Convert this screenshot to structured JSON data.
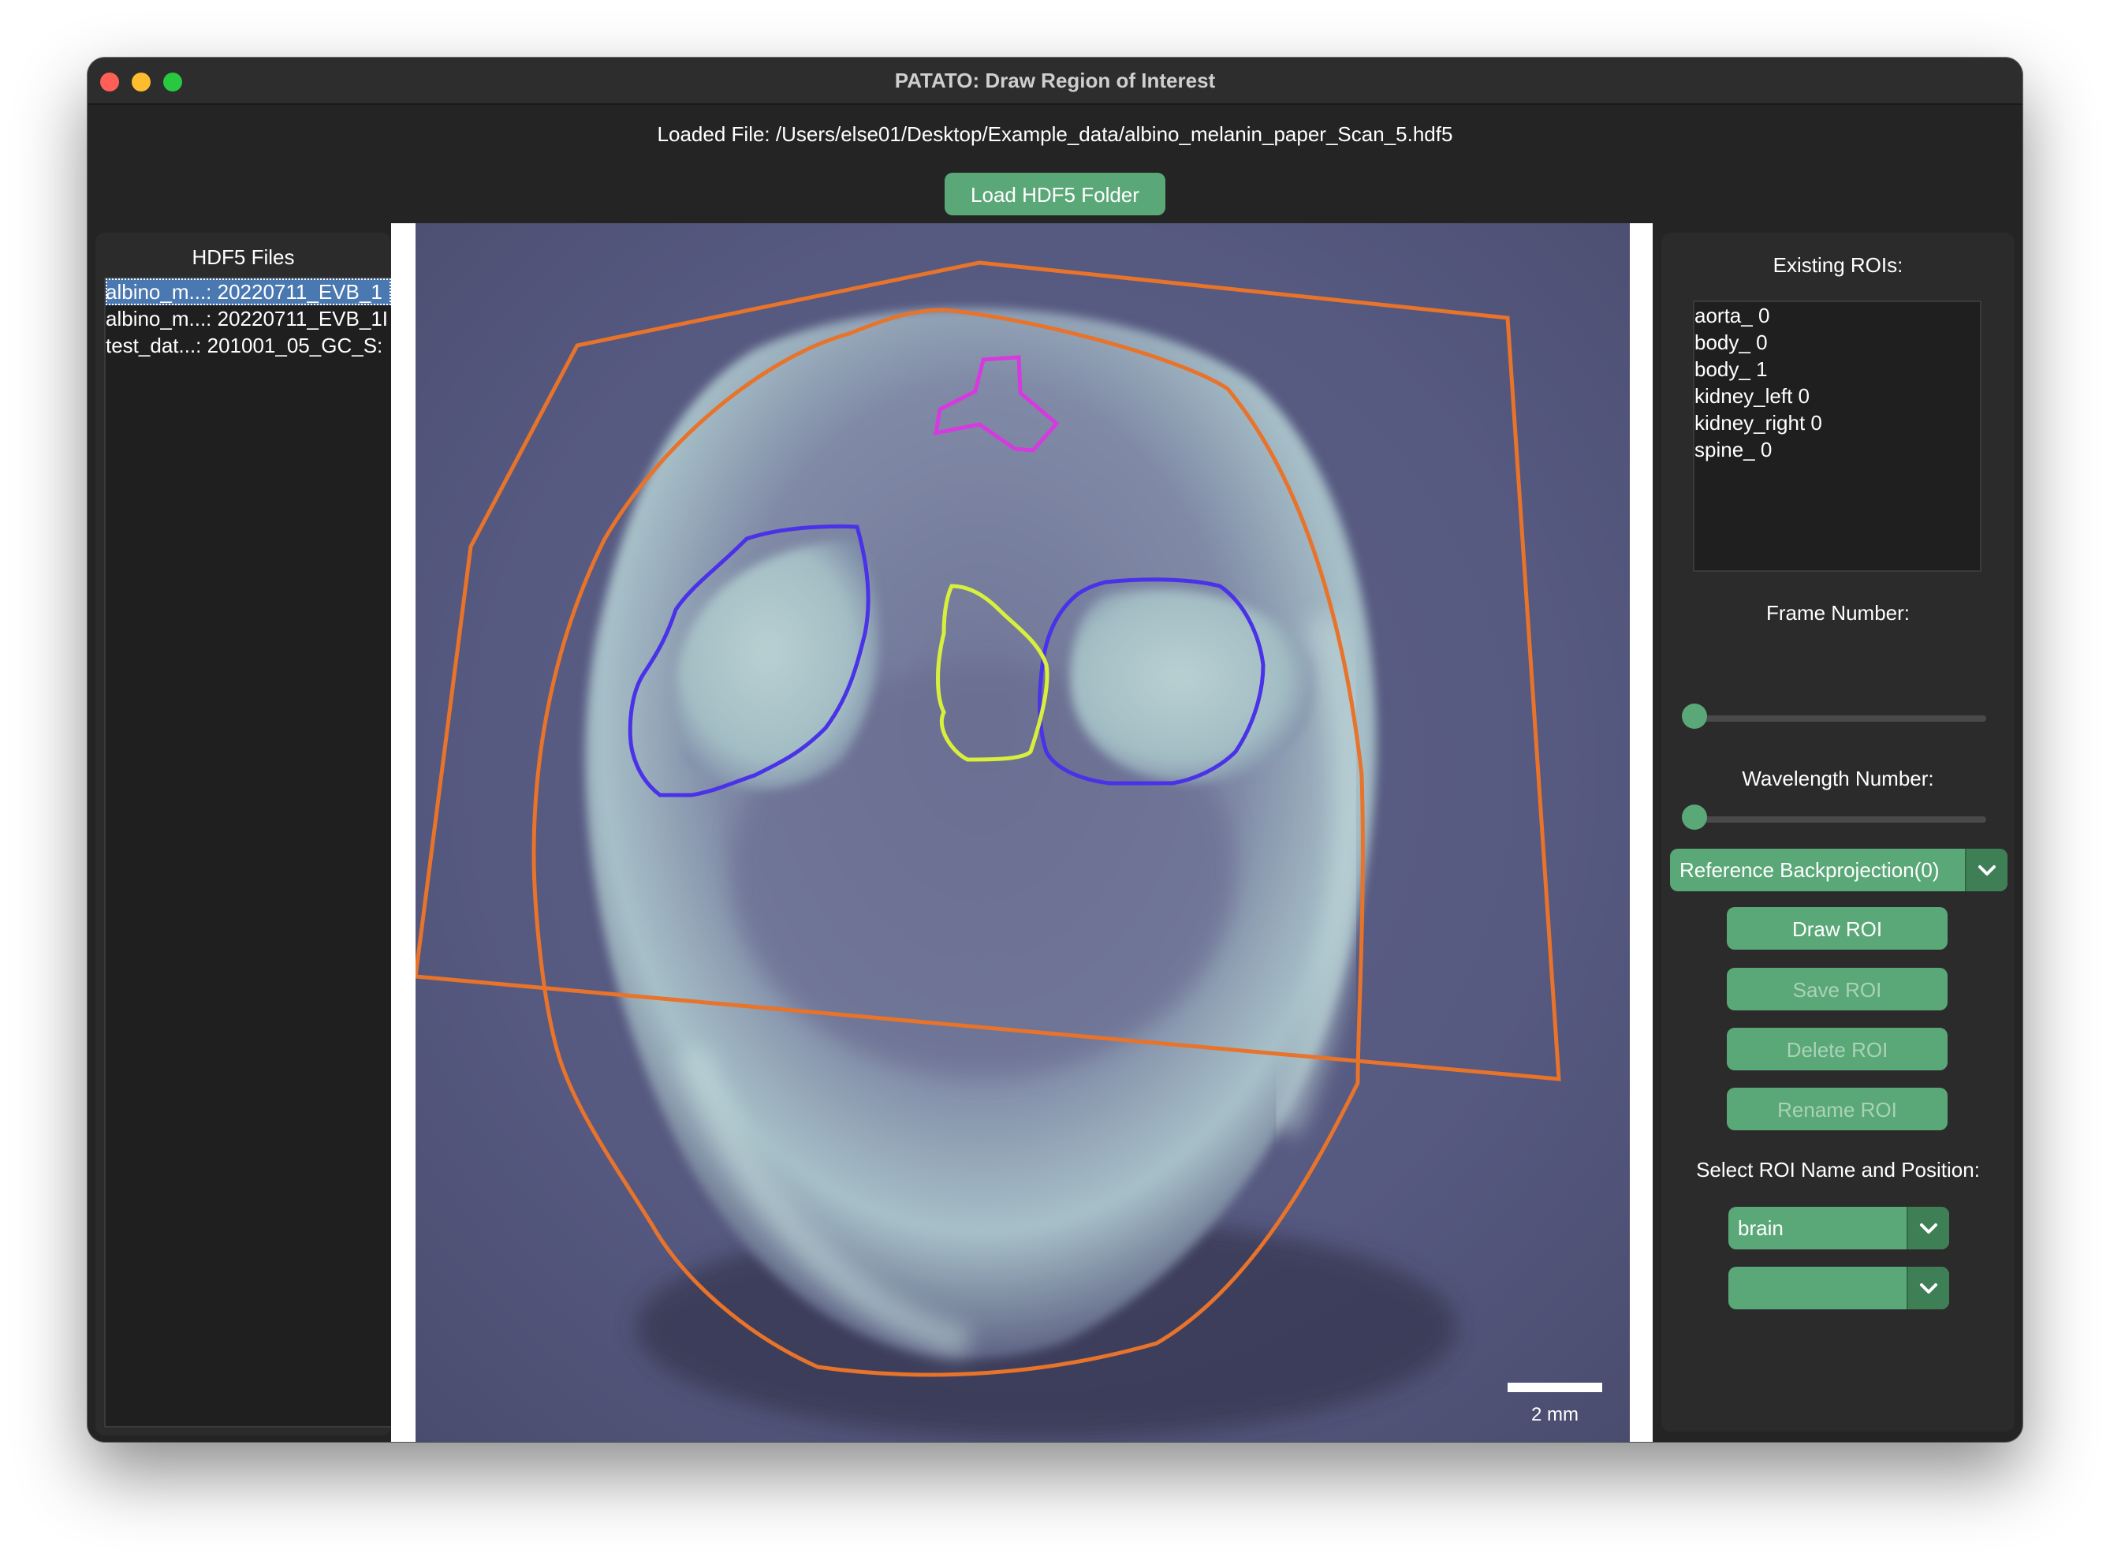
{
  "window": {
    "title": "PATATO: Draw Region of Interest",
    "loaded_file": "Loaded File: /Users/else01/Desktop/Example_data/albino_melanin_paper_Scan_5.hdf5",
    "load_button": "Load HDF5 Folder"
  },
  "file_panel": {
    "title": "HDF5 Files",
    "files": [
      "albino_m...: 20220711_EVB_1",
      "albino_m...: 20220711_EVB_1I",
      "test_dat...: 201001_05_GC_S:"
    ]
  },
  "image": {
    "scale_bar_label": "2 mm"
  },
  "right_panel": {
    "existing_rois_label": "Existing ROIs:",
    "rois": [
      "aorta_ 0",
      "body_ 0",
      "body_ 1",
      "kidney_left 0",
      "kidney_right 0",
      "spine_ 0"
    ],
    "frame_label": "Frame Number:",
    "frame_value": 0,
    "wavelength_label": "Wavelength Number:",
    "wavelength_value": 0,
    "recon_dropdown": "Reference Backprojection(0)",
    "draw_roi": "Draw ROI",
    "save_roi": "Save ROI",
    "delete_roi": "Delete ROI",
    "rename_roi": "Rename ROI",
    "select_label": "Select ROI Name and Position:",
    "roi_name_dropdown": "brain",
    "roi_position_dropdown": ""
  },
  "colors": {
    "accent_green": "#5aa878",
    "roi_orange": "#e8732a",
    "roi_blue": "#4a32e8",
    "roi_yellow": "#d8f03c",
    "roi_magenta": "#d63adf"
  }
}
